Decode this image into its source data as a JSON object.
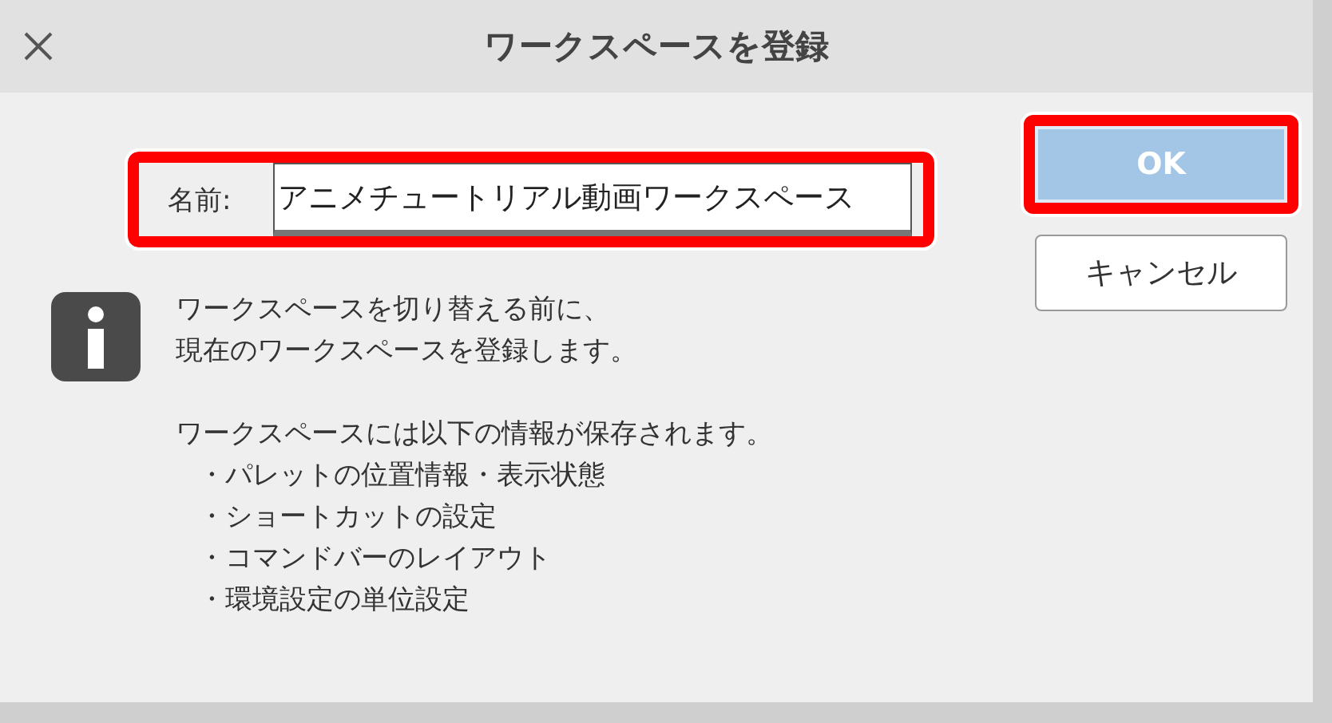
{
  "window": {
    "title": "ワークスペースを登録"
  },
  "name_field": {
    "label": "名前:",
    "value": "アニメチュートリアル動画ワークスペース",
    "highlighted": true
  },
  "buttons": [
    {
      "label": "OK",
      "kind": "primary",
      "highlighted": true
    },
    {
      "label": "キャンセル",
      "kind": "secondary",
      "highlighted": false
    }
  ],
  "message": {
    "intro": [
      "ワークスペースを切り替える前に、",
      "現在のワークスペースを登録します。"
    ],
    "lead": "ワークスペースには以下の情報が保存されます。",
    "bullets": [
      "・パレットの位置情報・表示状態",
      "・ショートカットの設定",
      "・コマンドバーのレイアウト",
      "・環境設定の単位設定"
    ]
  }
}
